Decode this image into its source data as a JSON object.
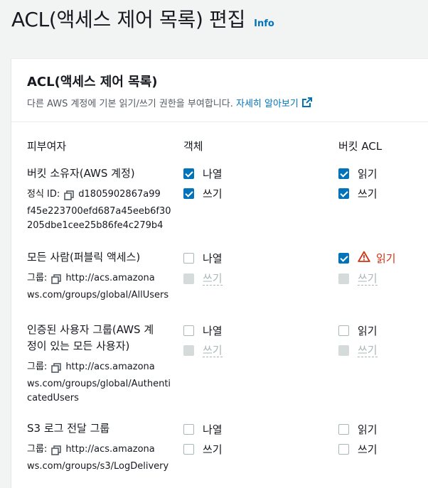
{
  "header": {
    "title": "ACL(액세스 제어 목록) 편집",
    "info": "Info"
  },
  "panel": {
    "title": "ACL(액세스 제어 목록)",
    "desc": "다른 AWS 계정에 기본 읽기/쓰기 권한을 부여합니다.",
    "learn_more": "자세히 알아보기"
  },
  "columns": {
    "grantee": "피부여자",
    "object": "객체",
    "bucket_acl": "버킷 ACL"
  },
  "grantees": [
    {
      "name": "버킷 소유자(AWS 계정)",
      "id_label": "정식 ID:",
      "id_lines": [
        "d1805902867a99",
        "f45e223700efd687a45eeb6f30",
        "205dbe1cee25b86fe4c279b4"
      ],
      "object": [
        {
          "label": "나열",
          "checked": true,
          "disabled": false
        },
        {
          "label": "쓰기",
          "checked": true,
          "disabled": false
        }
      ],
      "bucket": [
        {
          "label": "읽기",
          "checked": true,
          "disabled": false
        },
        {
          "label": "쓰기",
          "checked": true,
          "disabled": false
        }
      ]
    },
    {
      "name": "모든 사람(퍼블릭 액세스)",
      "group_label": "그룹:",
      "url_lines": [
        "http://acs.amazona",
        "ws.com/groups/global/AllUsers"
      ],
      "object": [
        {
          "label": "나열",
          "checked": false,
          "disabled": false
        },
        {
          "label": "쓰기",
          "checked": false,
          "disabled": true
        }
      ],
      "bucket": [
        {
          "label": "읽기",
          "checked": true,
          "disabled": false,
          "warning": true
        },
        {
          "label": "쓰기",
          "checked": false,
          "disabled": true
        }
      ]
    },
    {
      "name_lines": [
        "인증된 사용자 그룹(AWS 계",
        "정이 있는 모든 사용자)"
      ],
      "group_label": "그룹:",
      "url_lines": [
        "http://acs.amazona",
        "ws.com/groups/global/Authenti",
        "catedUsers"
      ],
      "object": [
        {
          "label": "나열",
          "checked": false,
          "disabled": false
        },
        {
          "label": "쓰기",
          "checked": false,
          "disabled": true
        }
      ],
      "bucket": [
        {
          "label": "읽기",
          "checked": false,
          "disabled": false
        },
        {
          "label": "쓰기",
          "checked": false,
          "disabled": true
        }
      ]
    },
    {
      "name": "S3 로그 전달 그룹",
      "group_label": "그룹:",
      "url_lines": [
        "http://acs.amazona",
        "ws.com/groups/s3/LogDelivery"
      ],
      "object": [
        {
          "label": "나열",
          "checked": false,
          "disabled": false
        },
        {
          "label": "쓰기",
          "checked": false,
          "disabled": false
        }
      ],
      "bucket": [
        {
          "label": "읽기",
          "checked": false,
          "disabled": false
        },
        {
          "label": "쓰기",
          "checked": false,
          "disabled": false
        }
      ]
    }
  ],
  "colors": {
    "link": "#0073bb",
    "checkbox": "#0073bb",
    "warning": "#d13212"
  }
}
